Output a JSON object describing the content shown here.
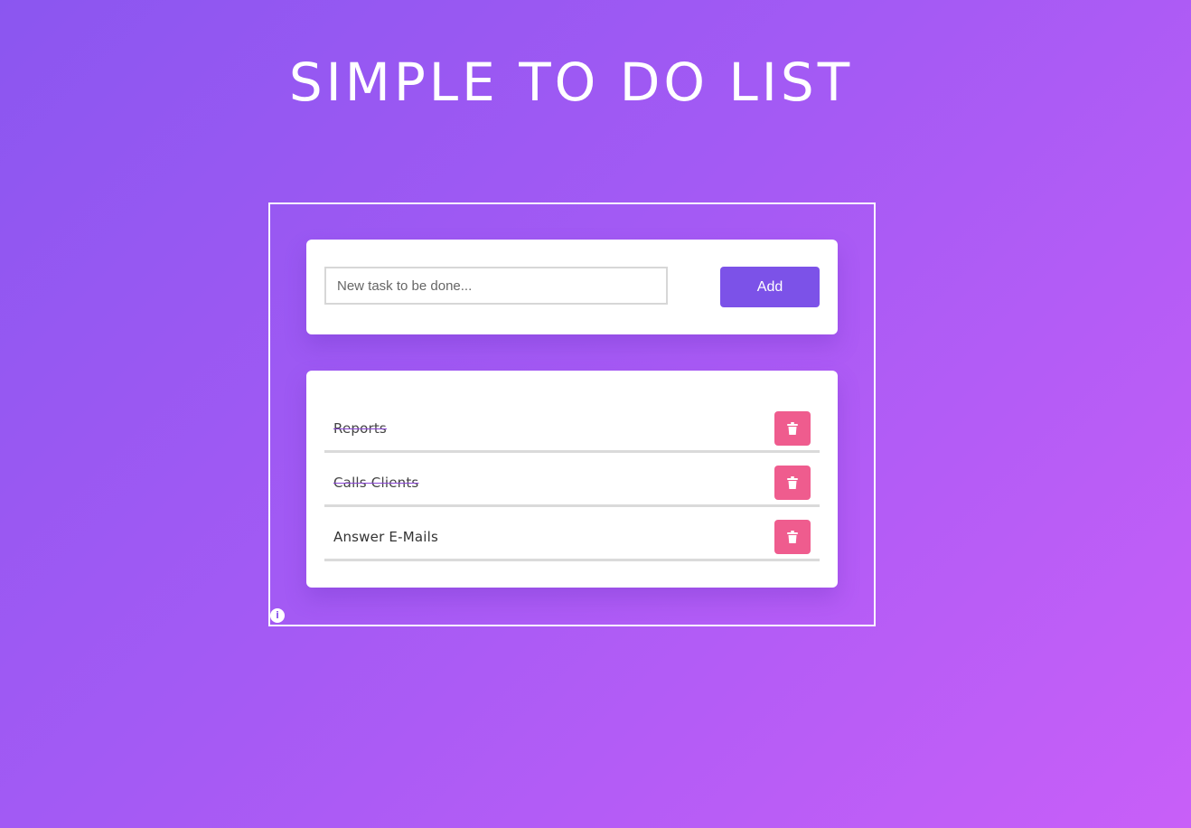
{
  "page": {
    "title": "SIMPLE TO DO LIST"
  },
  "input_card": {
    "placeholder": "New task to be done...",
    "add_label": "Add"
  },
  "tasks": [
    {
      "label": "Reports",
      "done": true
    },
    {
      "label": "Calls Clients",
      "done": true
    },
    {
      "label": "Answer E-Mails",
      "done": false
    }
  ],
  "icons": {
    "delete": "trash-icon",
    "info": "info-icon"
  },
  "colors": {
    "background_start": "#8b56f0",
    "background_end": "#c85ff8",
    "add_button": "#7c52e8",
    "delete_button": "#ef5c8e"
  }
}
